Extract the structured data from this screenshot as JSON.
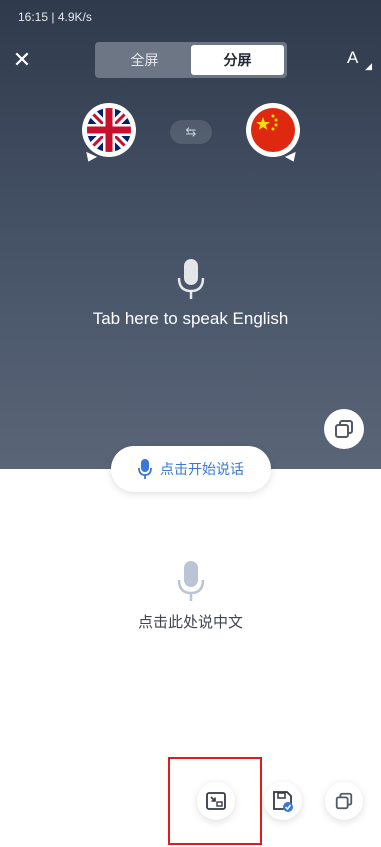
{
  "status_bar": {
    "text": "16:15 | 4.9K/s"
  },
  "header": {
    "close_icon": "close-icon",
    "mode_tabs": [
      {
        "label": "全屏",
        "active": false
      },
      {
        "label": "分屏",
        "active": true
      }
    ],
    "font_size_icon": "font-size-icon"
  },
  "languages": {
    "source": {
      "flag": "uk-flag-icon"
    },
    "target": {
      "flag": "china-flag-icon"
    },
    "swap_icon": "swap-arrows-icon"
  },
  "top_section": {
    "prompt": "Tab here to speak English",
    "copy_icon": "copy-icon"
  },
  "start_button": {
    "label": "点击开始说话",
    "color": "#3a78d6"
  },
  "bottom_section": {
    "prompt": "点击此处说中文"
  },
  "bottom_toolbar": {
    "icons": [
      "screenshot-icon",
      "save-icon",
      "copy-icon"
    ],
    "highlight_color": "#e01b1b"
  },
  "colors": {
    "panel_top": "#2f3a4c",
    "panel_bottom": "#5a6678",
    "accent": "#3a78d6"
  }
}
